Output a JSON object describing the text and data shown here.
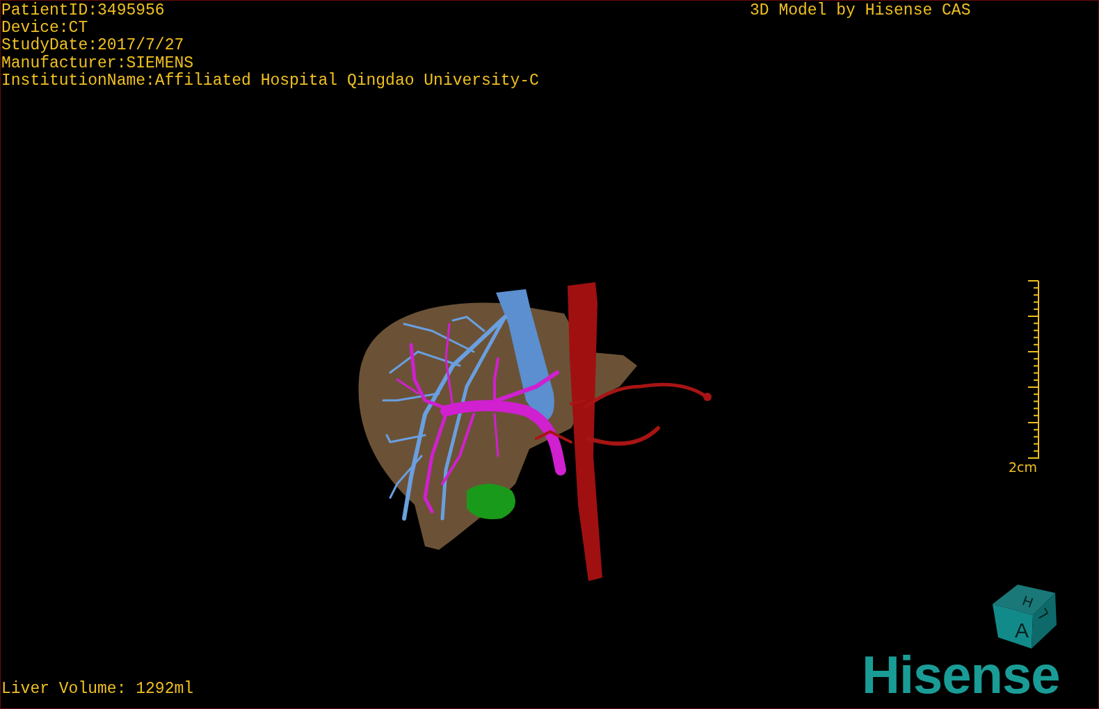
{
  "info_lines": [
    "PatientID:3495956",
    "Device:CT",
    "StudyDate:2017/7/27",
    "Manufacturer:SIEMENS",
    "InstitutionName:Affiliated Hospital Qingdao University-C"
  ],
  "title": "3D Model by Hisense CAS",
  "scale_bar": {
    "label": "2cm"
  },
  "orientation_cube": {
    "faces": [
      "H",
      "A",
      "L"
    ]
  },
  "logo": "Hisense",
  "liver_volume": "Liver Volume: 1292ml"
}
